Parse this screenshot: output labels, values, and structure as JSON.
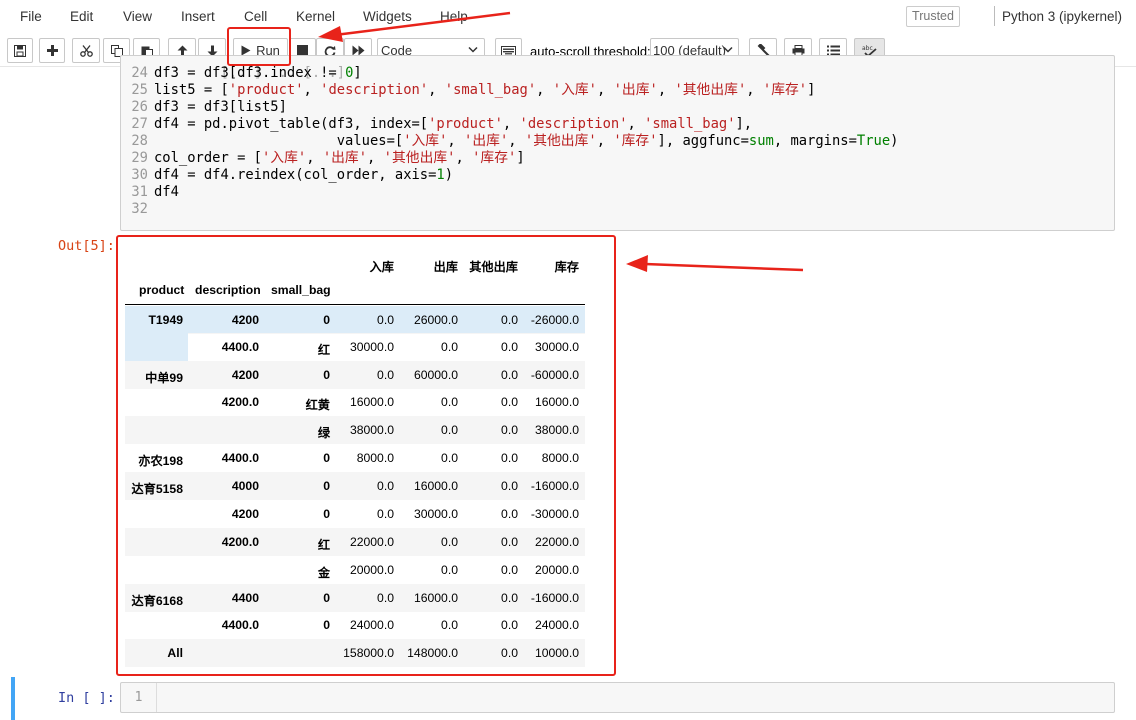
{
  "menubar": {
    "items": [
      "File",
      "Edit",
      "View",
      "Insert",
      "Cell",
      "Kernel",
      "Widgets",
      "Help"
    ],
    "trusted": "Trusted",
    "kernel": "Python 3 (ipykernel)"
  },
  "toolbar": {
    "run_label": "Run",
    "cell_type": "Code",
    "autoscroll_label": "auto-scroll threshold:",
    "autoscroll_value": "100 (default)"
  },
  "code": {
    "top_partial": "    [...] ... [...]",
    "lines": [
      {
        "n": "24",
        "segments": [
          {
            "t": "df3 = df3[df3.index != "
          },
          {
            "t": "0",
            "c": "num"
          },
          {
            "t": "]"
          }
        ]
      },
      {
        "n": "25",
        "segments": [
          {
            "t": "list5 = ["
          },
          {
            "t": "'product'",
            "c": "str"
          },
          {
            "t": ", "
          },
          {
            "t": "'description'",
            "c": "str"
          },
          {
            "t": ", "
          },
          {
            "t": "'small_bag'",
            "c": "str"
          },
          {
            "t": ", "
          },
          {
            "t": "'入库'",
            "c": "str"
          },
          {
            "t": ", "
          },
          {
            "t": "'出库'",
            "c": "str"
          },
          {
            "t": ", "
          },
          {
            "t": "'其他出库'",
            "c": "str"
          },
          {
            "t": ", "
          },
          {
            "t": "'库存'",
            "c": "str"
          },
          {
            "t": "]"
          }
        ]
      },
      {
        "n": "26",
        "segments": [
          {
            "t": "df3 = df3[list5]"
          }
        ]
      },
      {
        "n": "27",
        "segments": [
          {
            "t": "df4 = pd.pivot_table(df3, index=["
          },
          {
            "t": "'product'",
            "c": "str"
          },
          {
            "t": ", "
          },
          {
            "t": "'description'",
            "c": "str"
          },
          {
            "t": ", "
          },
          {
            "t": "'small_bag'",
            "c": "str"
          },
          {
            "t": "],"
          }
        ]
      },
      {
        "n": "28",
        "segments": [
          {
            "t": "                      values=["
          },
          {
            "t": "'入库'",
            "c": "str"
          },
          {
            "t": ", "
          },
          {
            "t": "'出库'",
            "c": "str"
          },
          {
            "t": ", "
          },
          {
            "t": "'其他出库'",
            "c": "str"
          },
          {
            "t": ", "
          },
          {
            "t": "'库存'",
            "c": "str"
          },
          {
            "t": "], aggfunc="
          },
          {
            "t": "sum",
            "c": "kw"
          },
          {
            "t": ", margins="
          },
          {
            "t": "True",
            "c": "kw"
          },
          {
            "t": ")"
          }
        ]
      },
      {
        "n": "29",
        "segments": [
          {
            "t": "col_order = ["
          },
          {
            "t": "'入库'",
            "c": "str"
          },
          {
            "t": ", "
          },
          {
            "t": "'出库'",
            "c": "str"
          },
          {
            "t": ", "
          },
          {
            "t": "'其他出库'",
            "c": "str"
          },
          {
            "t": ", "
          },
          {
            "t": "'库存'",
            "c": "str"
          },
          {
            "t": "]"
          }
        ]
      },
      {
        "n": "30",
        "segments": [
          {
            "t": "df4 = df4.reindex(col_order, axis="
          },
          {
            "t": "1",
            "c": "num"
          },
          {
            "t": ")"
          }
        ]
      },
      {
        "n": "31",
        "segments": [
          {
            "t": "df4"
          }
        ]
      },
      {
        "n": "32",
        "segments": [
          {
            "t": ""
          }
        ]
      }
    ]
  },
  "output": {
    "prompt": "Out[5]:",
    "columns": [
      "入库",
      "出库",
      "其他出库",
      "库存"
    ],
    "index_names": [
      "product",
      "description",
      "small_bag"
    ],
    "rows": [
      {
        "product": "T1949",
        "description": "4200",
        "small_bag": "0",
        "values": [
          "0.0",
          "26000.0",
          "0.0",
          "-26000.0"
        ]
      },
      {
        "product": "",
        "description": "4400.0",
        "small_bag": "红",
        "values": [
          "30000.0",
          "0.0",
          "0.0",
          "30000.0"
        ]
      },
      {
        "product": "中单99",
        "description": "4200",
        "small_bag": "0",
        "values": [
          "0.0",
          "60000.0",
          "0.0",
          "-60000.0"
        ]
      },
      {
        "product": "",
        "description": "4200.0",
        "small_bag": "红黄",
        "values": [
          "16000.0",
          "0.0",
          "0.0",
          "16000.0"
        ]
      },
      {
        "product": "",
        "description": "",
        "small_bag": "绿",
        "values": [
          "38000.0",
          "0.0",
          "0.0",
          "38000.0"
        ]
      },
      {
        "product": "亦农198",
        "description": "4400.0",
        "small_bag": "0",
        "values": [
          "8000.0",
          "0.0",
          "0.0",
          "8000.0"
        ]
      },
      {
        "product": "达育5158",
        "description": "4000",
        "small_bag": "0",
        "values": [
          "0.0",
          "16000.0",
          "0.0",
          "-16000.0"
        ]
      },
      {
        "product": "",
        "description": "4200",
        "small_bag": "0",
        "values": [
          "0.0",
          "30000.0",
          "0.0",
          "-30000.0"
        ]
      },
      {
        "product": "",
        "description": "4200.0",
        "small_bag": "红",
        "values": [
          "22000.0",
          "0.0",
          "0.0",
          "22000.0"
        ]
      },
      {
        "product": "",
        "description": "",
        "small_bag": "金",
        "values": [
          "20000.0",
          "0.0",
          "0.0",
          "20000.0"
        ]
      },
      {
        "product": "达育6168",
        "description": "4400",
        "small_bag": "0",
        "values": [
          "0.0",
          "16000.0",
          "0.0",
          "-16000.0"
        ]
      },
      {
        "product": "",
        "description": "4400.0",
        "small_bag": "0",
        "values": [
          "24000.0",
          "0.0",
          "0.0",
          "24000.0"
        ]
      },
      {
        "product": "All",
        "description": "",
        "small_bag": "",
        "values": [
          "158000.0",
          "148000.0",
          "0.0",
          "10000.0"
        ]
      }
    ]
  },
  "input_cell": {
    "prompt": "In [ ]:",
    "line_number": "1"
  },
  "colors": {
    "annotation_red": "#e8231a",
    "string": "#ba2121",
    "keyword": "#008000",
    "out_prompt": "#d84315",
    "in_prompt": "#303f9f",
    "selected_bar": "#42a5f5"
  }
}
